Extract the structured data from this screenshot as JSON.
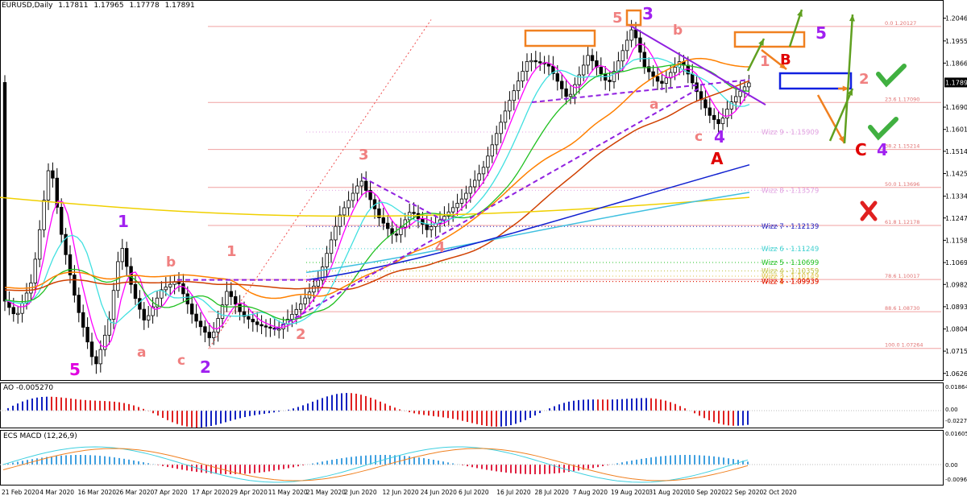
{
  "header": {
    "symbol": "EURUSD,Daily",
    "open": "1.17811",
    "high": "1.17965",
    "low": "1.17778",
    "close": "1.17891"
  },
  "chart_data": {
    "type": "candlestick",
    "instrument": "EURUSD,Daily",
    "price_axis_ticks": [
      "1.20460",
      "1.19550",
      "1.18665",
      "1.17891",
      "1.16905",
      "1.16015",
      "1.15140",
      "1.14250",
      "1.13345",
      "1.12475",
      "1.11585",
      "1.10695",
      "1.09820",
      "1.08930",
      "1.08040",
      "1.07155",
      "1.06265"
    ],
    "current_price": "1.17891",
    "date_ticks": [
      "21 Feb 2020",
      "4 Mar 2020",
      "16 Mar 2020",
      "26 Mar 2020",
      "7 Apr 2020",
      "17 Apr 2020",
      "29 Apr 2020",
      "11 May 2020",
      "21 May 2020",
      "2 Jun 2020",
      "12 Jun 2020",
      "24 Jun 2020",
      "6 Jul 2020",
      "16 Jul 2020",
      "28 Jul 2020",
      "7 Aug 2020",
      "19 Aug 2020",
      "31 Aug 2020",
      "10 Sep 2020",
      "22 Sep 2020",
      "2 Oct 2020"
    ],
    "fib_levels": [
      {
        "label": "0.0 1.20127",
        "price": 1.20127
      },
      {
        "label": "23.6 1.17090",
        "price": 1.1709
      },
      {
        "label": "38.2 1.15214",
        "price": 1.15214
      },
      {
        "label": "50.0 1.13696",
        "price": 1.13696
      },
      {
        "label": "61.8 1.12178",
        "price": 1.12178
      },
      {
        "label": "78.6 1.10017",
        "price": 1.10017
      },
      {
        "label": "88.6 1.08730",
        "price": 1.0873
      },
      {
        "label": "100.0 1.07264",
        "price": 1.07264
      }
    ],
    "wizz_levels": [
      {
        "label": "Wizz 9 - 1.15909",
        "price": 1.15909,
        "color": "#e0a0e0"
      },
      {
        "label": "Wizz 8 - 1.13579",
        "price": 1.13579,
        "color": "#e0a0e0"
      },
      {
        "label": "Wizz 7 - 1.12139",
        "price": 1.12139,
        "color": "#2020c0"
      },
      {
        "label": "Wizz 6 - 1.11249",
        "price": 1.11249,
        "color": "#40d0d0"
      },
      {
        "label": "Wizz 5 - 1.10699",
        "price": 1.10699,
        "color": "#20c020"
      },
      {
        "label": "Wizz 4 - 1.10359",
        "price": 1.10359,
        "color": "#c0c040"
      },
      {
        "label": "Wizz 3 - 1.10149",
        "price": 1.10149,
        "color": "#e0c040"
      },
      {
        "label": "Wizz 1 - 1.09939",
        "price": 1.09939,
        "color": "#f0a000"
      },
      {
        "label": "Wizz 4 - 1.09939",
        "price": 1.09939,
        "color": "#e00000"
      }
    ],
    "wave_labels": [
      {
        "text": "5",
        "color": "#e000e0"
      },
      {
        "text": "1",
        "color": "#a020f0"
      },
      {
        "text": "a",
        "color": "#f08080"
      },
      {
        "text": "b",
        "color": "#f08080"
      },
      {
        "text": "c",
        "color": "#f08080"
      },
      {
        "text": "2",
        "color": "#a020f0"
      },
      {
        "text": "1",
        "color": "#f08080"
      },
      {
        "text": "2",
        "color": "#f08080"
      },
      {
        "text": "3",
        "color": "#f08080"
      },
      {
        "text": "4",
        "color": "#f08080"
      },
      {
        "text": "5",
        "color": "#f08080"
      },
      {
        "text": "3",
        "color": "#a020f0"
      },
      {
        "text": "a",
        "color": "#f08080"
      },
      {
        "text": "b",
        "color": "#f08080"
      },
      {
        "text": "c",
        "color": "#f08080"
      },
      {
        "text": "4",
        "color": "#a020f0"
      },
      {
        "text": "A",
        "color": "#e00000"
      },
      {
        "text": "1",
        "color": "#f08080"
      },
      {
        "text": "B",
        "color": "#e00000"
      },
      {
        "text": "5",
        "color": "#a020f0"
      },
      {
        "text": "2",
        "color": "#f08080"
      },
      {
        "text": "C",
        "color": "#e00000"
      },
      {
        "text": "4",
        "color": "#a020f0"
      }
    ],
    "ao": {
      "label": "AO -0.005270",
      "ticks": [
        "0.01864",
        "0.00",
        "-0.0227"
      ]
    },
    "macd": {
      "label": "ECS MACD (12,26,9)",
      "ticks": [
        "0.0160563",
        "0.00",
        "-0.009627"
      ]
    }
  }
}
